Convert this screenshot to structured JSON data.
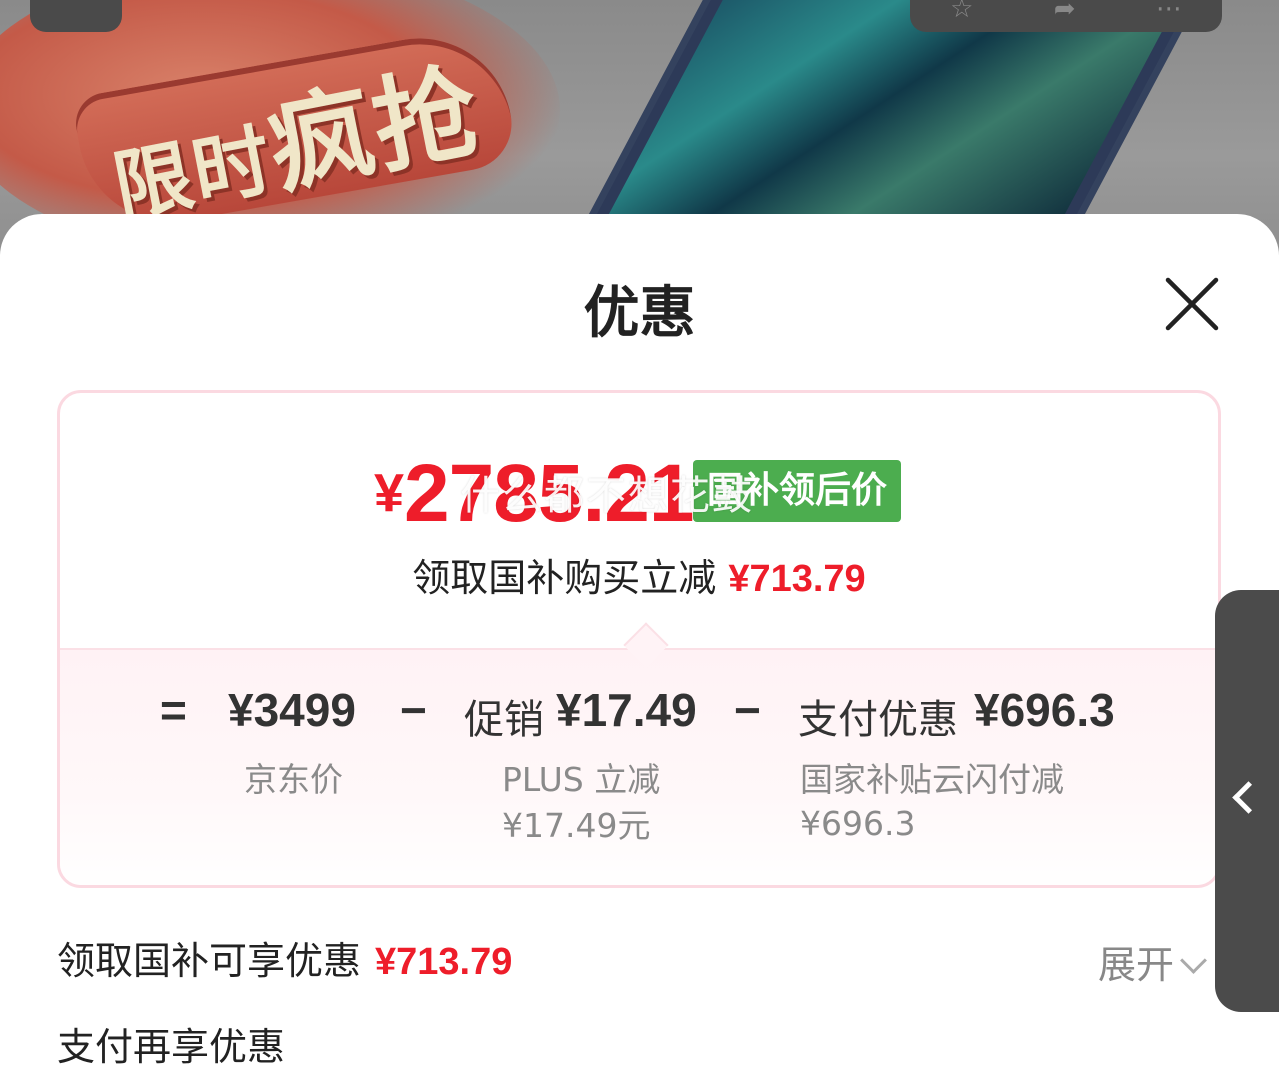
{
  "banner": {
    "promo_text_small": "限时",
    "promo_text_big": "疯抢"
  },
  "sheet": {
    "title": "优惠"
  },
  "price": {
    "currency": "¥",
    "final_amount": "2785.21",
    "tag": "国补领后价",
    "watermark": "什么都不想花鼓",
    "saving_label": "领取国补购买立减",
    "saving_amount": "¥713.79"
  },
  "calculation": {
    "equals": "=",
    "base_price": "¥3499",
    "base_label": "京东价",
    "minus1": "−",
    "promo_label": "促销",
    "promo_amount": "¥17.49",
    "promo_sub1": "PLUS 立减",
    "promo_sub2": "¥17.49元",
    "minus2": "−",
    "pay_label": "支付优惠",
    "pay_amount": "¥696.3",
    "pay_sub1": "国家补贴云闪付减",
    "pay_sub2": "¥696.3"
  },
  "rows": {
    "subsidy_label": "领取国补可享优惠",
    "subsidy_amount": "¥713.79",
    "expand_label": "展开",
    "payment_label": "支付再享优惠"
  },
  "colors": {
    "accent_red": "#ee1d2a",
    "tag_green": "#4cad4f"
  }
}
